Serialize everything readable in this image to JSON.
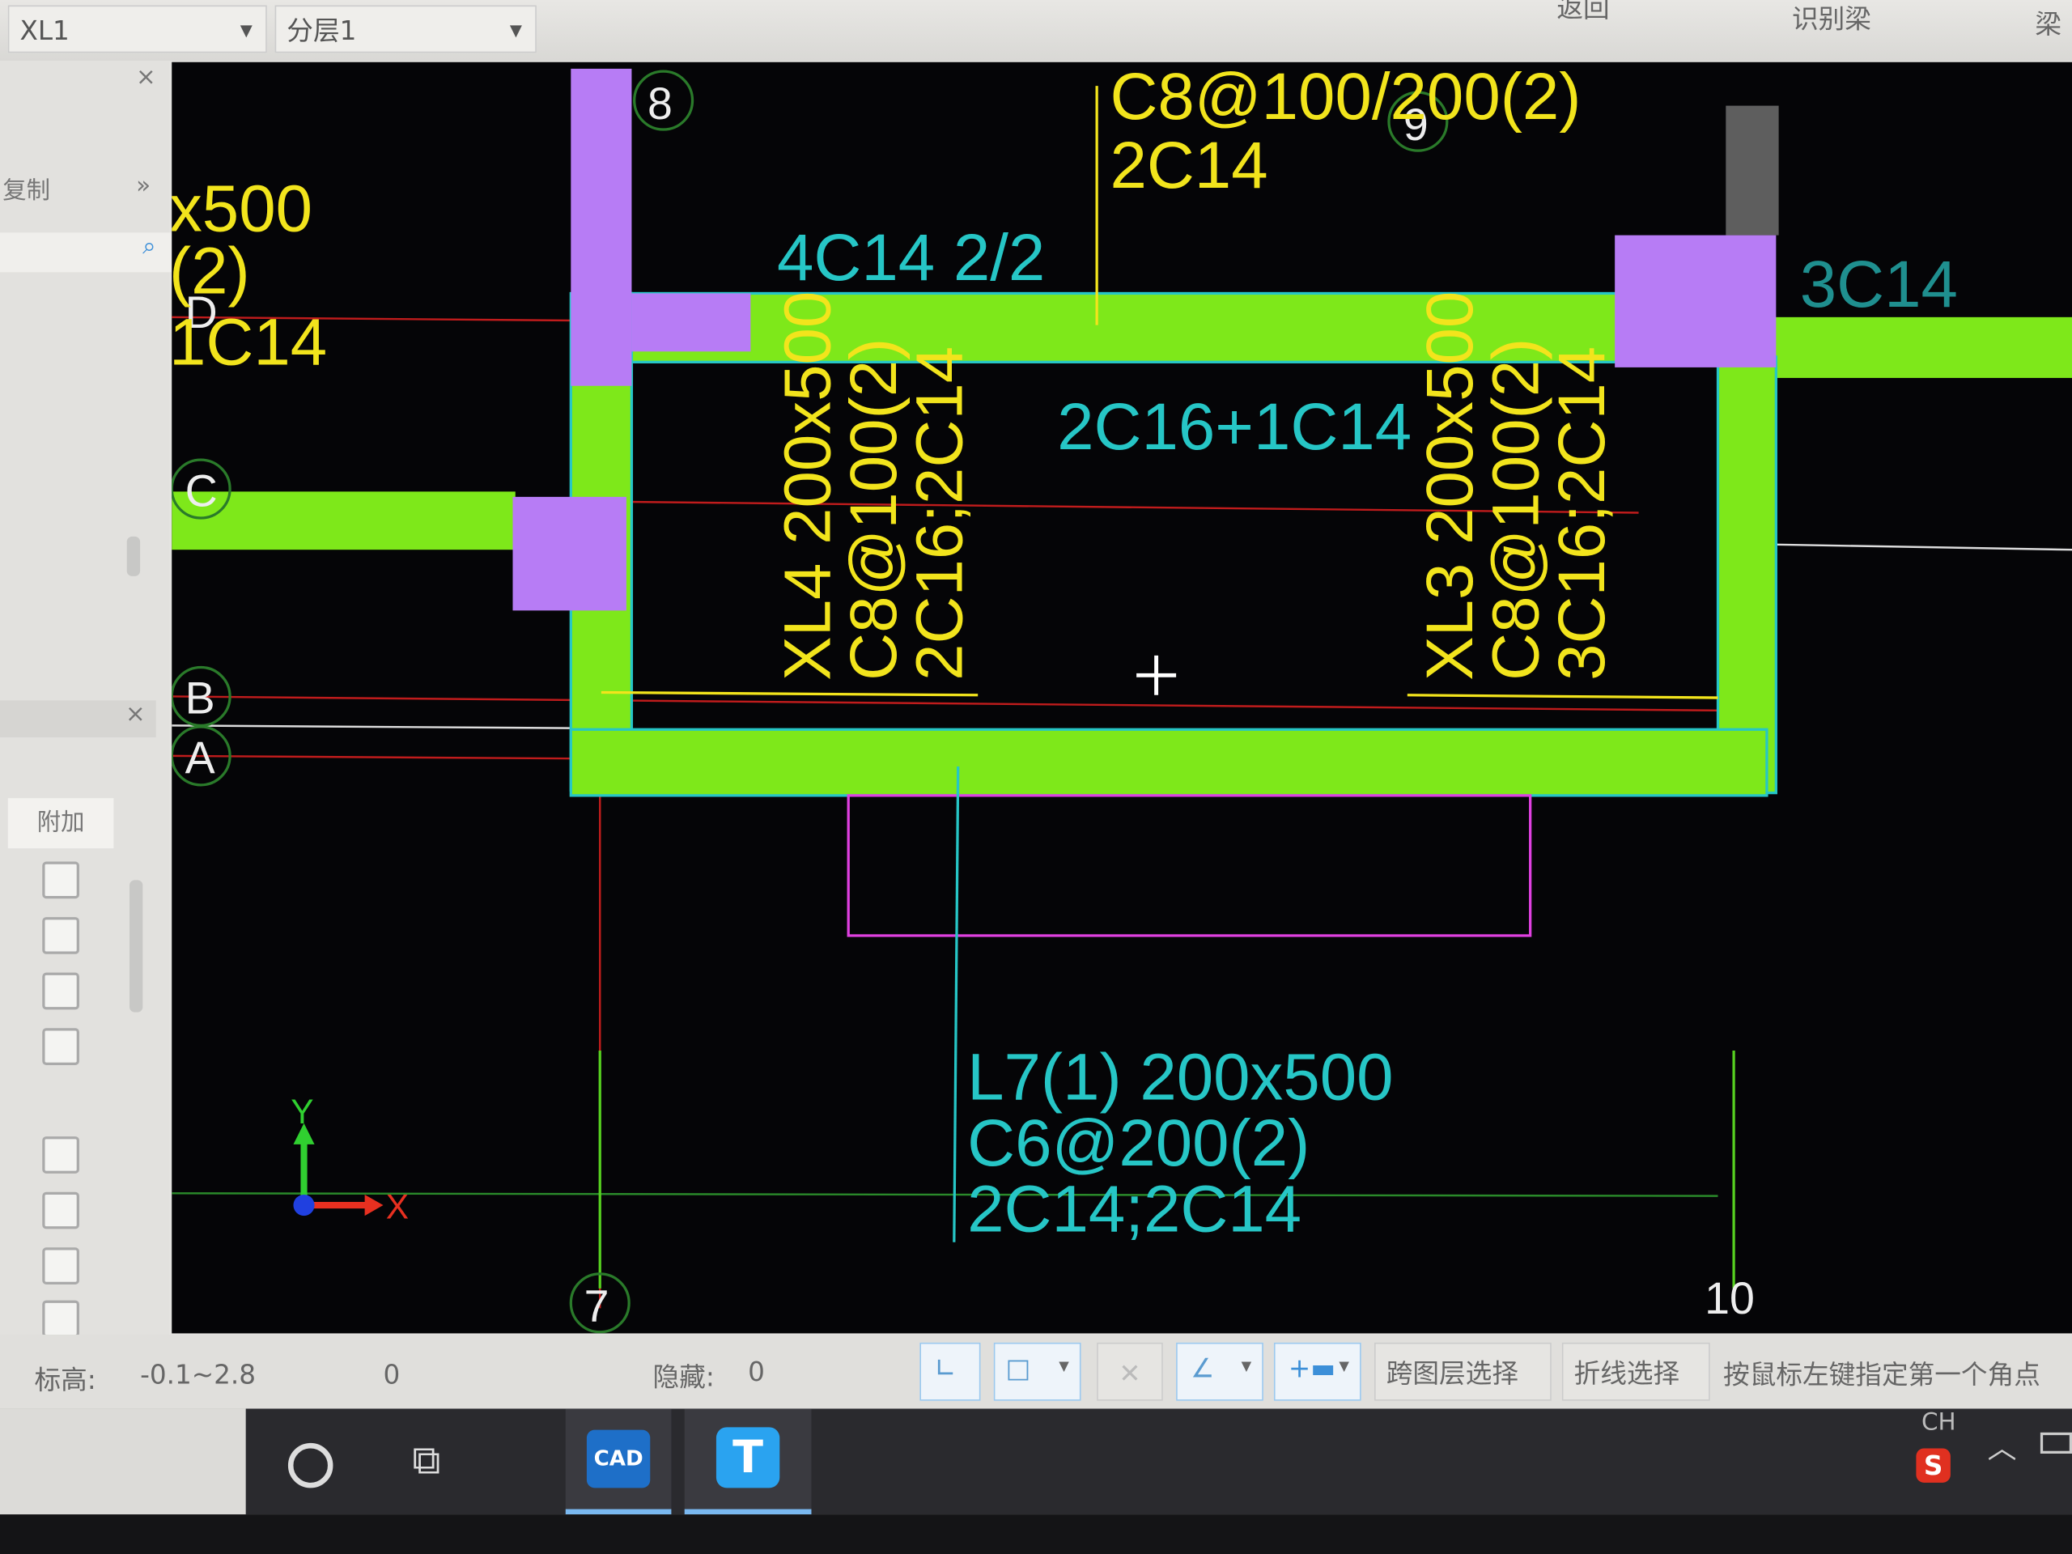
{
  "toolbar": {
    "component_select": "XL1",
    "layer_select": "分层1",
    "right_items": [
      "返回",
      "识别梁",
      "梁"
    ]
  },
  "left_panel": {
    "copy_label": "复制",
    "more": "»",
    "tab_label": "附加",
    "close": "×",
    "checkbox_count": 8
  },
  "canvas": {
    "axis_labels": {
      "top_8": "8",
      "top_9": "9",
      "bottom_7": "7",
      "bottom_10": "10",
      "D": "D",
      "C": "C",
      "B": "B",
      "A": "A"
    },
    "texts": {
      "left_partial_1": "x500",
      "left_partial_2": "(2)",
      "left_partial_3": "1C14",
      "top_stirrup": "C8@100/200(2)",
      "top_bars": "2C14",
      "beam_4c14": "4C14 2/2",
      "right_3c14": "3C14",
      "mid_2c16": "2C16+1C14",
      "xl4_1": "XL4 200x500",
      "xl4_2": "C8@100(2)",
      "xl4_3": "2C16;2C14",
      "xl3_1": "XL3 200x500",
      "xl3_2": "C8@100(2)",
      "xl3_3": "3C16;2C14",
      "l7_1": "L7(1) 200x500",
      "l7_2": "C6@200(2)",
      "l7_3": "2C14;2C14",
      "ucs_x": "X",
      "ucs_y": "Y"
    },
    "colors": {
      "beam": "#7ee81a",
      "column": "#b77cf5",
      "yellow": "#f2e41c",
      "cyan": "#26c6c6",
      "magenta": "#e040e0",
      "red": "#d0201e"
    }
  },
  "status": {
    "elevation_label": "标高:",
    "elevation_value": "-0.1~2.8",
    "count": "0",
    "hidden_label": "隐藏:",
    "hidden_value": "0",
    "cross_layer": "跨图层选择",
    "polyline_select": "折线选择",
    "prompt": "按鼠标左键指定第一个角点"
  },
  "taskbar": {
    "cad_label": "CAD",
    "t_label": "T",
    "ime": "CH",
    "sogou": "S"
  }
}
